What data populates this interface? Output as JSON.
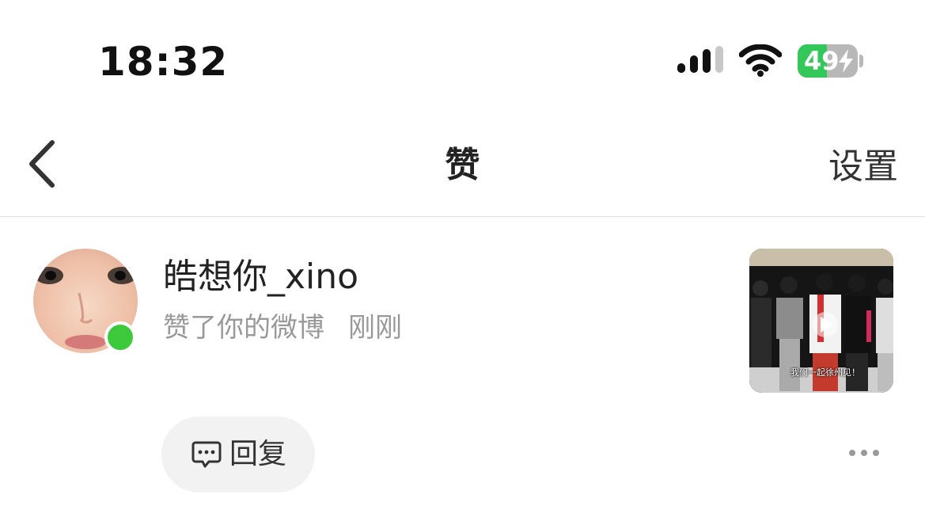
{
  "status_bar": {
    "time": "18:32",
    "battery_level": "49",
    "battery_percent": 49,
    "cellular_bars": 3,
    "icons": [
      "signal-icon",
      "wifi-icon",
      "battery-charging-icon"
    ]
  },
  "nav": {
    "back_icon": "chevron-left-icon",
    "title": "赞",
    "settings_label": "设置"
  },
  "notification": {
    "username": "皓想你_xino",
    "online": true,
    "action": "赞了你的微博",
    "time_ago": "刚刚",
    "thumbnail_caption": "我们一起徐州见！",
    "reply_icon": "comment-icon",
    "reply_label": "回复",
    "more_icon": "more-dots-icon"
  },
  "colors": {
    "online_green": "#3cc93c",
    "battery_green": "#34c759",
    "secondary_text": "#999999",
    "reply_bg": "#f2f2f2"
  }
}
